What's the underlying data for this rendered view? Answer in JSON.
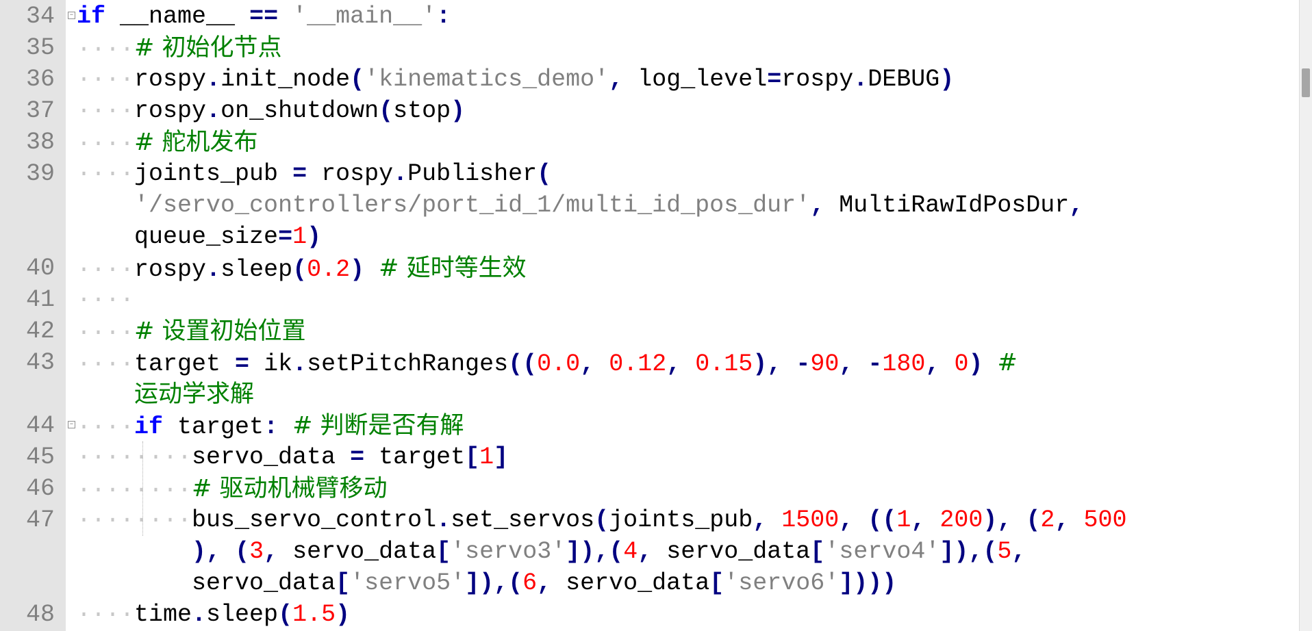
{
  "editor": {
    "lines": [
      {
        "num": "34",
        "fold": "⊟",
        "html": "<span class=\"kw\">if</span> __name__ <span class=\"op\">==</span> <span class=\"str\">'__main__'</span><span class=\"op\">:</span>"
      },
      {
        "num": "35",
        "html": "<span class=\"ws\">····</span><span class=\"cm\"># 初始化节点</span>"
      },
      {
        "num": "36",
        "html": "<span class=\"ws\">····</span>rospy<span class=\"op\">.</span>init_node<span class=\"op\">(</span><span class=\"str\">'kinematics_demo'</span><span class=\"op\">,</span> log_level<span class=\"op\">=</span>rospy<span class=\"op\">.</span>DEBUG<span class=\"op\">)</span>"
      },
      {
        "num": "37",
        "html": "<span class=\"ws\">····</span>rospy<span class=\"op\">.</span>on_shutdown<span class=\"op\">(</span>stop<span class=\"op\">)</span>"
      },
      {
        "num": "38",
        "html": "<span class=\"ws\">····</span><span class=\"cm\"># 舵机发布</span>"
      },
      {
        "num": "39",
        "html": "<span class=\"ws\">····</span>joints_pub <span class=\"op\">=</span> rospy<span class=\"op\">.</span>Publisher<span class=\"op\">(</span>"
      },
      {
        "num": "",
        "html": "    <span class=\"str\">'/servo_controllers/port_id_1/multi_id_pos_dur'</span><span class=\"op\">,</span> MultiRawIdPosDur<span class=\"op\">,</span>"
      },
      {
        "num": "",
        "html": "    queue_size<span class=\"op\">=</span><span class=\"num\">1</span><span class=\"op\">)</span>"
      },
      {
        "num": "40",
        "html": "<span class=\"ws\">····</span>rospy<span class=\"op\">.</span>sleep<span class=\"op\">(</span><span class=\"num\">0.2</span><span class=\"op\">)</span> <span class=\"cm\"># 延时等生效</span>"
      },
      {
        "num": "41",
        "html": "<span class=\"ws\">····</span>"
      },
      {
        "num": "42",
        "html": "<span class=\"ws\">····</span><span class=\"cm\"># 设置初始位置</span>"
      },
      {
        "num": "43",
        "html": "<span class=\"ws\">····</span>target <span class=\"op\">=</span> ik<span class=\"op\">.</span>setPitchRanges<span class=\"op\">((</span><span class=\"num\">0.0</span><span class=\"op\">,</span> <span class=\"num\">0.12</span><span class=\"op\">,</span> <span class=\"num\">0.15</span><span class=\"op\">),</span> <span class=\"op\">-</span><span class=\"num\">90</span><span class=\"op\">,</span> <span class=\"op\">-</span><span class=\"num\">180</span><span class=\"op\">,</span> <span class=\"num\">0</span><span class=\"op\">)</span> <span class=\"cm\">#</span>"
      },
      {
        "num": "",
        "html": "    <span class=\"cm\">运动学求解</span>"
      },
      {
        "num": "44",
        "fold": "⊟",
        "html": "<span class=\"ws\">····</span><span class=\"kw\">if</span> target<span class=\"op\">:</span> <span class=\"cm\"># 判断是否有解</span>"
      },
      {
        "num": "45",
        "html": "<span class=\"ws\">····</span><span class=\"ws\">····</span>servo_data <span class=\"op\">=</span> target<span class=\"op\">[</span><span class=\"num\">1</span><span class=\"op\">]</span>"
      },
      {
        "num": "46",
        "html": "<span class=\"ws\">····</span><span class=\"ws\">····</span><span class=\"cm\"># 驱动机械臂移动</span>"
      },
      {
        "num": "47",
        "html": "<span class=\"ws\">····</span><span class=\"ws\">····</span>bus_servo_control<span class=\"op\">.</span>set_servos<span class=\"op\">(</span>joints_pub<span class=\"op\">,</span> <span class=\"num\">1500</span><span class=\"op\">,</span> <span class=\"op\">((</span><span class=\"num\">1</span><span class=\"op\">,</span> <span class=\"num\">200</span><span class=\"op\">),</span> <span class=\"op\">(</span><span class=\"num\">2</span><span class=\"op\">,</span> <span class=\"num\">500</span>"
      },
      {
        "num": "",
        "html": "        <span class=\"op\">),</span> <span class=\"op\">(</span><span class=\"num\">3</span><span class=\"op\">,</span> servo_data<span class=\"op\">[</span><span class=\"str\">'servo3'</span><span class=\"op\">]),(</span><span class=\"num\">4</span><span class=\"op\">,</span> servo_data<span class=\"op\">[</span><span class=\"str\">'servo4'</span><span class=\"op\">]),(</span><span class=\"num\">5</span><span class=\"op\">,</span>"
      },
      {
        "num": "",
        "html": "        servo_data<span class=\"op\">[</span><span class=\"str\">'servo5'</span><span class=\"op\">]),(</span><span class=\"num\">6</span><span class=\"op\">,</span> servo_data<span class=\"op\">[</span><span class=\"str\">'servo6'</span><span class=\"op\">])))</span>"
      },
      {
        "num": "48",
        "html": "<span class=\"ws\">····</span>time<span class=\"op\">.</span>sleep<span class=\"op\">(</span><span class=\"num\">1.5</span><span class=\"op\">)</span>"
      }
    ]
  }
}
